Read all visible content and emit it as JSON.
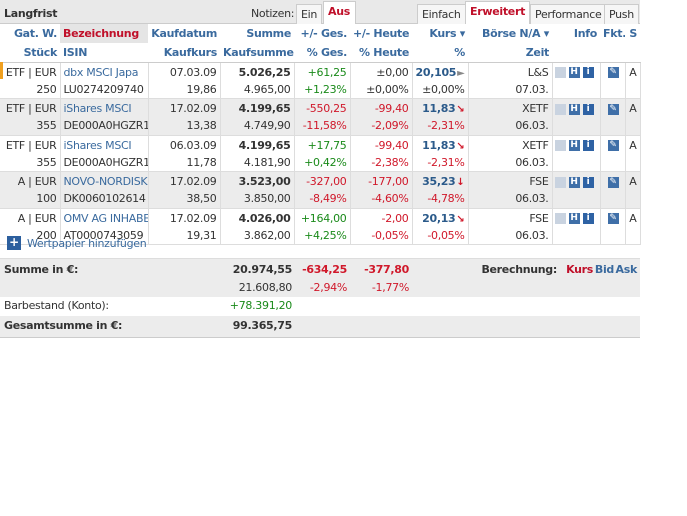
{
  "header": {
    "title": "Langfrist",
    "notes_label": "Notizen:",
    "notes_tabs": [
      "Ein",
      "Aus"
    ],
    "notes_active": "Aus",
    "view_tabs": [
      "Einfach",
      "Erweitert",
      "Performance",
      "Push"
    ],
    "view_active": "Erweitert"
  },
  "columns": {
    "row1": [
      "Gat. W.",
      "Bezeichnung",
      "Kaufdatum",
      "Summe",
      "+/- Ges.",
      "+/- Heute",
      "Kurs ▾",
      "Börse N/A ▾",
      "Info",
      "Fkt.",
      "S"
    ],
    "row2": [
      "Stück",
      "ISIN",
      "Kaufkurs",
      "Kaufsumme",
      "% Ges.",
      "% Heute",
      "%",
      "Zeit",
      "",
      "",
      ""
    ]
  },
  "rows": [
    {
      "type": "ETF | EUR",
      "name": "dbx MSCI Japa",
      "date": "07.03.09",
      "sum": "5.026,25",
      "ges": "+61,25",
      "heute": "±0,00",
      "kurs": "20,105",
      "trend": "flat",
      "boerse": "L&S",
      "qty": "250",
      "isin": "LU0274209740",
      "kaufkurs": "19,86",
      "kaufsumme": "4.965,00",
      "ges_pct": "+1,23%",
      "heute_pct": "±0,00%",
      "kurs_pct": "±0,00%",
      "zeit": "07.03.",
      "s": "A"
    },
    {
      "type": "ETF | EUR",
      "name": "iShares MSCI",
      "date": "17.02.09",
      "sum": "4.199,65",
      "ges": "-550,25",
      "heute": "-99,40",
      "kurs": "11,83",
      "trend": "down",
      "boerse": "XETF",
      "qty": "355",
      "isin": "DE000A0HGZR1",
      "kaufkurs": "13,38",
      "kaufsumme": "4.749,90",
      "ges_pct": "-11,58%",
      "heute_pct": "-2,09%",
      "kurs_pct": "-2,31%",
      "zeit": "06.03.",
      "s": "A"
    },
    {
      "type": "ETF | EUR",
      "name": "iShares MSCI",
      "date": "06.03.09",
      "sum": "4.199,65",
      "ges": "+17,75",
      "heute": "-99,40",
      "kurs": "11,83",
      "trend": "down",
      "boerse": "XETF",
      "qty": "355",
      "isin": "DE000A0HGZR1",
      "kaufkurs": "11,78",
      "kaufsumme": "4.181,90",
      "ges_pct": "+0,42%",
      "heute_pct": "-2,38%",
      "kurs_pct": "-2,31%",
      "zeit": "06.03.",
      "s": "A"
    },
    {
      "type": "A | EUR",
      "name": "NOVO-NORDISK",
      "date": "17.02.09",
      "sum": "3.523,00",
      "ges": "-327,00",
      "heute": "-177,00",
      "kurs": "35,23",
      "trend": "strongdown",
      "boerse": "FSE",
      "qty": "100",
      "isin": "DK0060102614",
      "kaufkurs": "38,50",
      "kaufsumme": "3.850,00",
      "ges_pct": "-8,49%",
      "heute_pct": "-4,60%",
      "kurs_pct": "-4,78%",
      "zeit": "06.03.",
      "s": "A"
    },
    {
      "type": "A | EUR",
      "name": "OMV AG INHABE",
      "date": "17.02.09",
      "sum": "4.026,00",
      "ges": "+164,00",
      "heute": "-2,00",
      "kurs": "20,13",
      "trend": "down",
      "boerse": "FSE",
      "qty": "200",
      "isin": "AT0000743059",
      "kaufkurs": "19,31",
      "kaufsumme": "3.862,00",
      "ges_pct": "+4,25%",
      "heute_pct": "-0,05%",
      "kurs_pct": "-0,05%",
      "zeit": "06.03.",
      "s": "A"
    }
  ],
  "add_label": "Wertpapier hinzufügen",
  "summary": {
    "label": "Summe in €:",
    "sum": "20.974,55",
    "ges": "-634,25",
    "heute": "-377,80",
    "kaufsumme": "21.608,80",
    "ges_pct": "-2,94%",
    "heute_pct": "-1,77%",
    "calc_label": "Berechnung:",
    "calc_options": [
      "Kurs",
      "Bid",
      "Ask"
    ],
    "calc_active": "Kurs",
    "cash_label": "Barbestand (Konto):",
    "cash": "+78.391,20",
    "total_label": "Gesamtsumme in €:",
    "total": "99.365,75"
  },
  "colors": {
    "accent_red": "#c0102a",
    "link_blue": "#3a6a9e",
    "positive": "#1a8a1a",
    "negative": "#d0182a"
  }
}
